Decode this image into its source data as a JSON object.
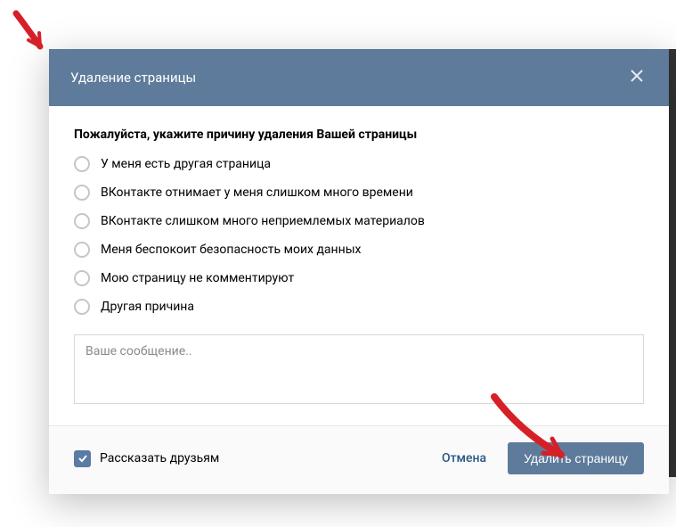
{
  "modal": {
    "title": "Удаление страницы",
    "prompt": "Пожалуйста, укажите причину удаления Вашей страницы",
    "options": [
      "У меня есть другая страница",
      "ВКонтакте отнимает у меня слишком много времени",
      "ВКонтакте слишком много неприемлемых материалов",
      "Меня беспокоит безопасность моих данных",
      "Мою страницу не комментируют",
      "Другая причина"
    ],
    "message_placeholder": "Ваше сообщение..",
    "tell_friends_label": "Рассказать друзьям",
    "tell_friends_checked": true,
    "cancel_label": "Отмена",
    "delete_label": "Удалить страницу"
  },
  "colors": {
    "header_bg": "#5e7b9b",
    "primary_btn": "#5e7b9b",
    "link": "#2a5885",
    "arrow": "#d62027"
  }
}
